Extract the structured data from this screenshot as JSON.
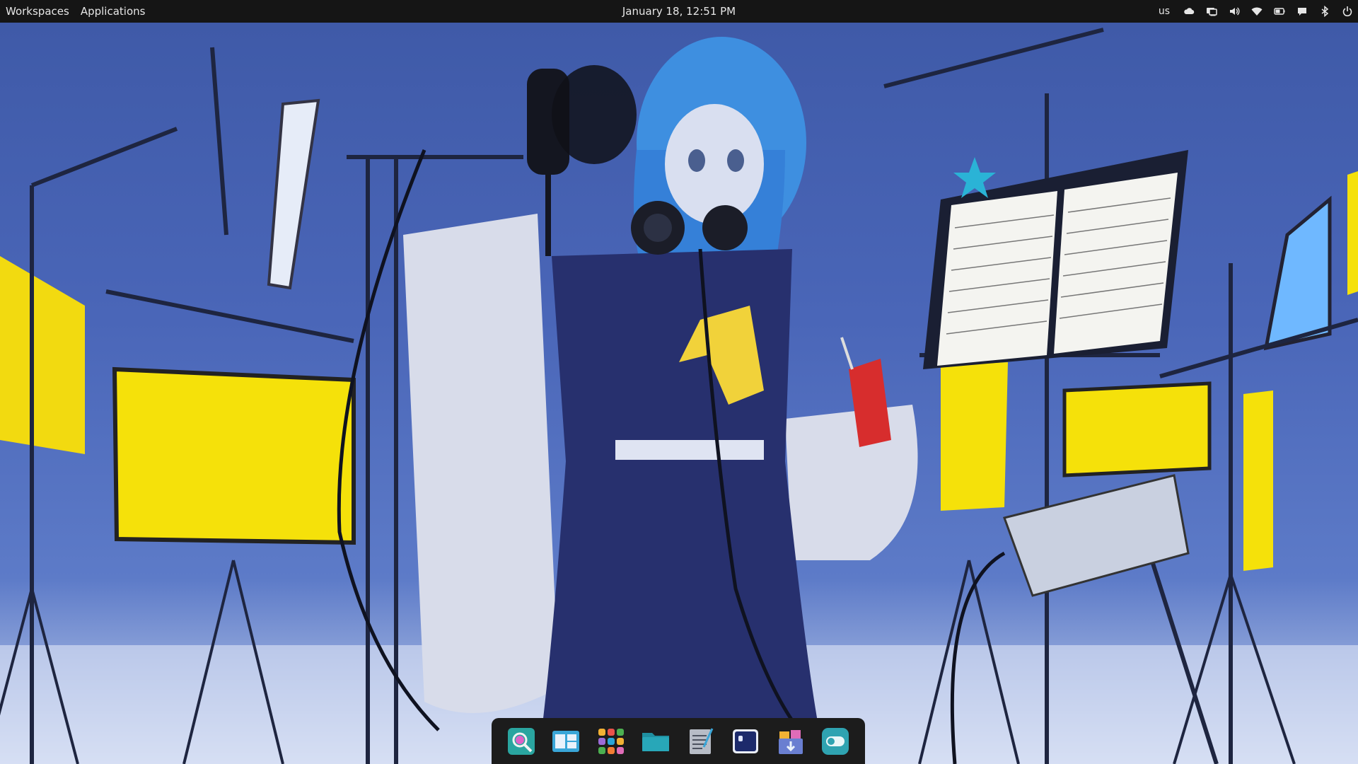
{
  "panel": {
    "workspaces_label": "Workspaces",
    "applications_label": "Applications",
    "clock": "January 18, 12:51 PM",
    "keyboard_layout": "us",
    "tray_icons": [
      "cloud-icon",
      "display-icon",
      "volume-icon",
      "wifi-icon",
      "battery-icon",
      "notification-icon",
      "bluetooth-icon",
      "power-icon"
    ]
  },
  "wallpaper": {
    "description_icon": "anime-recording-studio-wallpaper"
  },
  "dock": {
    "apps": [
      {
        "name": "search-app-icon",
        "color": "#2aa5a0"
      },
      {
        "name": "window-switcher-icon",
        "color": "#3aa6d8"
      },
      {
        "name": "app-grid-icon",
        "color": "#f2b134"
      },
      {
        "name": "files-folder-icon",
        "color": "#28a7b8"
      },
      {
        "name": "text-editor-icon",
        "color": "#8a8f99"
      },
      {
        "name": "terminal-icon",
        "color": "#1c2a6b"
      },
      {
        "name": "store-installer-icon",
        "color": "#6a7fd1"
      },
      {
        "name": "settings-toggle-icon",
        "color": "#2fa3b1"
      }
    ]
  },
  "colors": {
    "panel_bg": "#151515",
    "dock_bg": "#1c1c1c",
    "accent_yellow": "#f5e10a",
    "wall_blue": "#4a66b8"
  }
}
